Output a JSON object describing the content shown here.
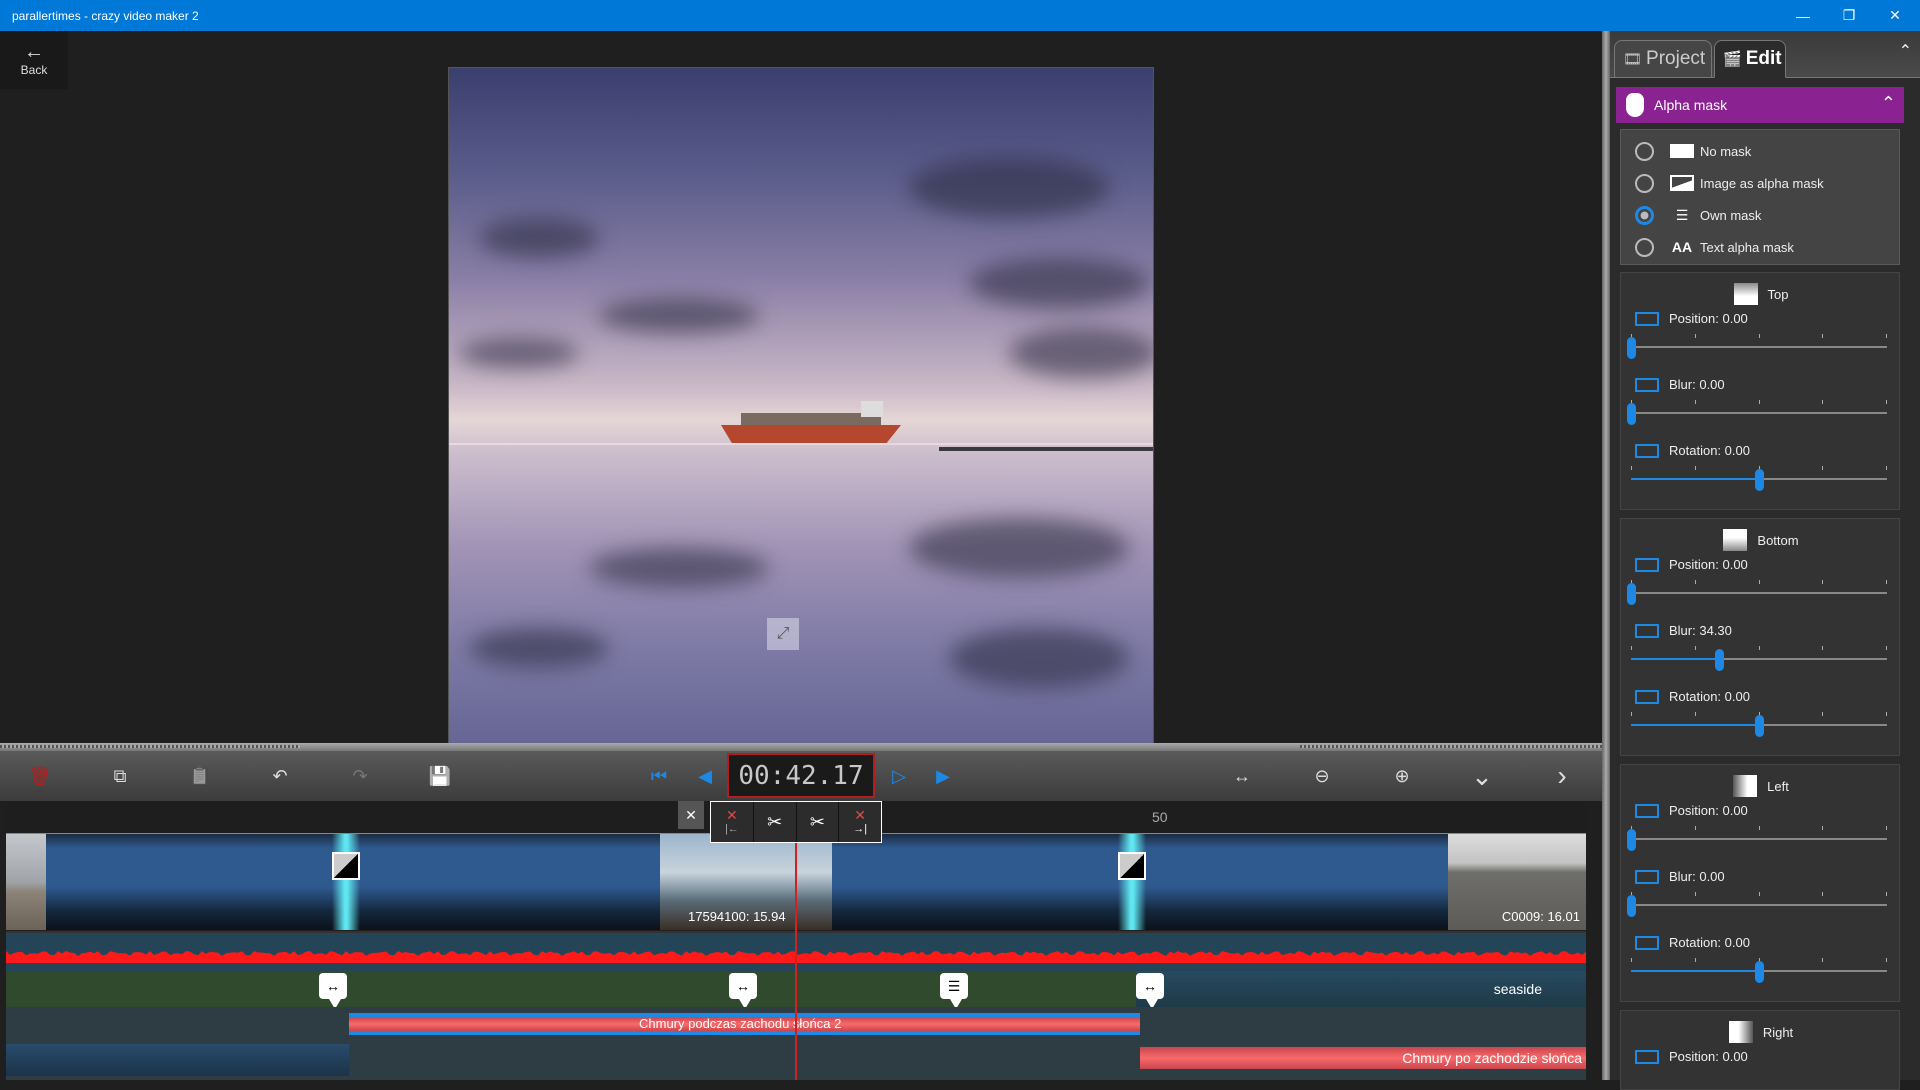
{
  "window": {
    "title": "parallertimes - crazy video maker 2",
    "minimize_glyph": "—",
    "restore_glyph": "❐",
    "close_glyph": "✕"
  },
  "back": {
    "label": "Back",
    "icon": "←"
  },
  "preview": {
    "fullscreen_icon": "⤢"
  },
  "toolbar": {
    "delete_icon": "🗑",
    "copy_icon": "⧉",
    "paste_icon": "📋",
    "undo_icon": "↶",
    "redo_icon": "↷",
    "save_icon": "💾",
    "go_start_icon": "⏮",
    "prev_frame_icon": "◀",
    "timecode": "00:42.17",
    "play_icon": "▷",
    "next_frame_icon": "▶",
    "fit_icon": "↔",
    "zoom_out_icon": "⊖",
    "zoom_in_icon": "⊕",
    "more_down_icon": "⌄",
    "next_icon": "›"
  },
  "cut_tools": {
    "close": "✕",
    "cut_left_x": "✕",
    "cut_left_arrow": "|←",
    "split_icon": "✂",
    "split2_icon": "✂",
    "cut_right_x": "✕",
    "cut_right_arrow": "→|"
  },
  "timeline": {
    "ruler_label": "50",
    "video_clips": [
      {
        "label": "17594100: 15.94"
      },
      {
        "label": "C0009: 16.01"
      }
    ],
    "effect_track": {
      "label": "seaside"
    },
    "text_clips": [
      {
        "label": "Chmury podczas zachodu słońca 2"
      },
      {
        "label": "Chmury po zachodzie słońca"
      }
    ],
    "marker_icons": {
      "move": "↔",
      "adjust": "☰"
    }
  },
  "panel": {
    "tabs": [
      {
        "label": "Project",
        "icon": "🎞"
      },
      {
        "label": "Edit",
        "icon": "🎬",
        "active": true
      }
    ],
    "collapse_icon": "⌃",
    "alpha_mask": {
      "title": "Alpha mask",
      "chevron": "⌃",
      "options": [
        {
          "label": "No mask",
          "selected": false
        },
        {
          "label": "Image as alpha mask",
          "selected": false
        },
        {
          "label": "Own mask",
          "selected": true
        },
        {
          "label": "Text alpha mask",
          "selected": false
        }
      ],
      "text_mask_icon": "AA"
    },
    "sections": [
      {
        "title": "Top",
        "params": [
          {
            "label": "Position: 0.00",
            "value_fraction": 0.0
          },
          {
            "label": "Blur: 0.00",
            "value_fraction": 0.0
          },
          {
            "label": "Rotation: 0.00",
            "value_fraction": 0.5
          }
        ]
      },
      {
        "title": "Bottom",
        "params": [
          {
            "label": "Position: 0.00",
            "value_fraction": 0.0
          },
          {
            "label": "Blur: 34.30",
            "value_fraction": 0.343
          },
          {
            "label": "Rotation: 0.00",
            "value_fraction": 0.5
          }
        ]
      },
      {
        "title": "Left",
        "params": [
          {
            "label": "Position: 0.00",
            "value_fraction": 0.0
          },
          {
            "label": "Blur: 0.00",
            "value_fraction": 0.0
          },
          {
            "label": "Rotation: 0.00",
            "value_fraction": 0.5
          }
        ]
      },
      {
        "title": "Right",
        "params": [
          {
            "label": "Position: 0.00",
            "value_fraction": 0.0
          }
        ]
      }
    ]
  },
  "colors": {
    "titlebar": "#0078d7",
    "accent": "#1e88e5",
    "alpha_header": "#8a2391",
    "playhead": "#d42020",
    "text_clip": "#f86a6a"
  }
}
